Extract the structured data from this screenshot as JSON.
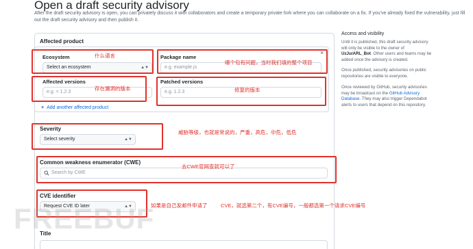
{
  "header": {
    "title": "Open a draft security advisory",
    "intro": "After the draft security advisory is open, you can privately discuss it with collaborators and create a temporary private fork where you can collaborate on a fix. If you've already fixed the vulnerability, just fill out the draft security advisory and then publish it."
  },
  "affected_product": {
    "heading": "Affected product",
    "ecosystem": {
      "label": "Ecosystem",
      "value": "Select an ecosystem"
    },
    "package_name": {
      "label": "Package name",
      "placeholder": "e.g. example.js"
    },
    "affected_versions": {
      "label": "Affected versions",
      "placeholder": "e.g. < 1.2.3"
    },
    "patched_versions": {
      "label": "Patched versions",
      "placeholder": "e.g. 1.2.3"
    },
    "close_symbol": "×",
    "add_another_label": "Add another affected product",
    "add_symbol": "+"
  },
  "severity": {
    "label": "Severity",
    "value": "Select severity"
  },
  "cwe": {
    "label": "Common weakness enumerator (CWE)",
    "placeholder": "Search by CWE",
    "icon": "search-icon"
  },
  "cve": {
    "label": "CVE identifier",
    "value": "Request CVE ID later"
  },
  "title_field": {
    "label": "Title"
  },
  "sidebar": {
    "heading": "Access and visibility",
    "p1_a": "Until it is published, this draft security advisory will only be visible to the owner of ",
    "p1_owner": "UzJu/ARL_Bot",
    "p1_b": ". Other users and teams may be added once the advisory is created.",
    "p2": "Once published, security advisories on public repositories are visible to everyone.",
    "p3_a": "Once reviewed by GitHub, security advisories may be broadcast on the ",
    "p3_link": "GitHub Advisory Database",
    "p3_b": ". They may also trigger Dependabot alerts to users that depend on this repository."
  },
  "annotations": {
    "ecosystem_note": "什么语言",
    "package_note": "哪个包有问题，当时我们填的整个项目",
    "affected_note": "存在漏洞的版本",
    "patched_note": "修复的版本",
    "severity_note": "威胁等级，也就是常说的，严重，高危，中危，低危",
    "cwe_note": "去CWE官网查就可以了",
    "cve_note_1": "如果是自己发邮件申请了",
    "cve_note_2": "CVE，就选第二个，有CVE编号，一般都选第一个请求CVE编号"
  },
  "watermark": "FREEBUF",
  "colors": {
    "annotation_red": "#e0312a",
    "link_blue": "#0969da",
    "border_gray": "#d1d9e0"
  }
}
